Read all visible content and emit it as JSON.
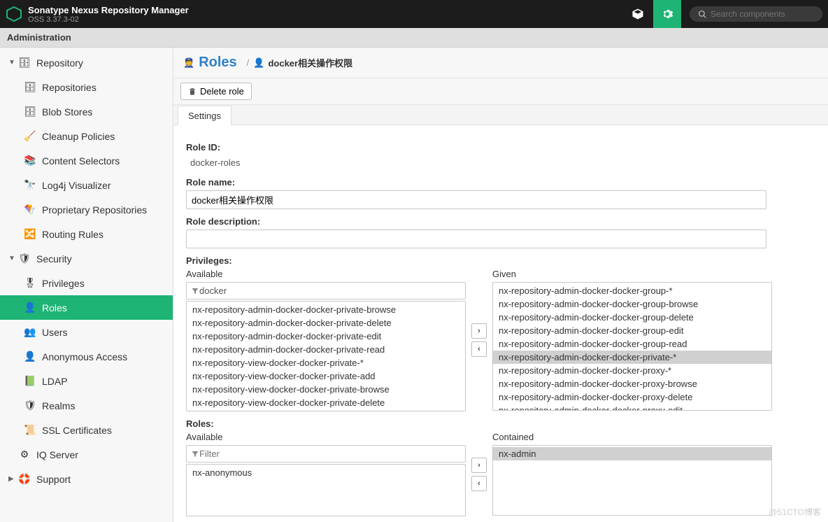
{
  "header": {
    "title": "Sonatype Nexus Repository Manager",
    "version": "OSS 3.37.3-02",
    "search_placeholder": "Search components"
  },
  "admin_bar": "Administration",
  "sidebar": [
    {
      "caret": "▼",
      "label": "Repository",
      "level": 1,
      "icon": "database"
    },
    {
      "label": "Repositories",
      "level": 2,
      "icon": "database"
    },
    {
      "label": "Blob Stores",
      "level": 2,
      "icon": "server"
    },
    {
      "label": "Cleanup Policies",
      "level": 2,
      "icon": "broom"
    },
    {
      "label": "Content Selectors",
      "level": 2,
      "icon": "layers"
    },
    {
      "label": "Log4j Visualizer",
      "level": 2,
      "icon": "binoculars"
    },
    {
      "label": "Proprietary Repositories",
      "level": 2,
      "icon": "kite"
    },
    {
      "label": "Routing Rules",
      "level": 2,
      "icon": "route"
    },
    {
      "caret": "▼",
      "label": "Security",
      "level": 1,
      "icon": "shield"
    },
    {
      "label": "Privileges",
      "level": 2,
      "icon": "badge"
    },
    {
      "label": "Roles",
      "level": 2,
      "icon": "user-badge",
      "active": true
    },
    {
      "label": "Users",
      "level": 2,
      "icon": "users"
    },
    {
      "label": "Anonymous Access",
      "level": 2,
      "icon": "user"
    },
    {
      "label": "LDAP",
      "level": 2,
      "icon": "book"
    },
    {
      "label": "Realms",
      "level": 2,
      "icon": "shield-out"
    },
    {
      "label": "SSL Certificates",
      "level": 2,
      "icon": "cert"
    },
    {
      "caret": "",
      "label": "IQ Server",
      "level": 1,
      "icon": "iq"
    },
    {
      "caret": "▶",
      "label": "Support",
      "level": 1,
      "icon": "life-ring"
    }
  ],
  "breadcrumb": {
    "title": "Roles",
    "sub": "docker相关操作权限"
  },
  "toolbar": {
    "delete": "Delete role"
  },
  "tabs": [
    {
      "label": "Settings"
    }
  ],
  "form": {
    "role_id_label": "Role ID:",
    "role_id": "docker-roles",
    "role_name_label": "Role name:",
    "role_name": "docker相关操作权限",
    "role_desc_label": "Role description:",
    "role_desc": "",
    "priv_label": "Privileges:",
    "available": "Available",
    "given": "Given",
    "filter_value": "docker",
    "filter_placeholder": "Filter",
    "priv_available": [
      "nx-repository-admin-docker-docker-private-browse",
      "nx-repository-admin-docker-docker-private-delete",
      "nx-repository-admin-docker-docker-private-edit",
      "nx-repository-admin-docker-docker-private-read",
      "nx-repository-view-docker-docker-private-*",
      "nx-repository-view-docker-docker-private-add",
      "nx-repository-view-docker-docker-private-browse",
      "nx-repository-view-docker-docker-private-delete"
    ],
    "priv_given": [
      {
        "t": "nx-repository-admin-docker-docker-group-*"
      },
      {
        "t": "nx-repository-admin-docker-docker-group-browse"
      },
      {
        "t": "nx-repository-admin-docker-docker-group-delete"
      },
      {
        "t": "nx-repository-admin-docker-docker-group-edit"
      },
      {
        "t": "nx-repository-admin-docker-docker-group-read"
      },
      {
        "t": "nx-repository-admin-docker-docker-private-*",
        "sel": true
      },
      {
        "t": "nx-repository-admin-docker-docker-proxy-*"
      },
      {
        "t": "nx-repository-admin-docker-docker-proxy-browse"
      },
      {
        "t": "nx-repository-admin-docker-docker-proxy-delete"
      },
      {
        "t": "nx-repository-admin-docker-docker-proxy-edit"
      }
    ],
    "roles_label": "Roles:",
    "contained": "Contained",
    "roles_available": [
      "nx-anonymous"
    ],
    "roles_contained": [
      {
        "t": "nx-admin",
        "sel": true
      }
    ]
  },
  "watermark": "@51CTO博客"
}
